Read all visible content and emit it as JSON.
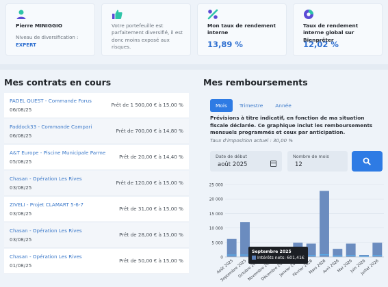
{
  "cards": [
    {
      "icon": "user-icon",
      "title": "Pierre MINIGGIO",
      "sub_label": "Niveau de diversification :",
      "level": "EXPERT"
    },
    {
      "icon": "thumbs-up-icon",
      "text": "Votre portefeuille est parfaitement diversifié, il est donc moins exposé aux risques."
    },
    {
      "icon": "percent-icon",
      "title": "Mon taux de rendement interne",
      "value": "13,89 %"
    },
    {
      "icon": "chart-circle-icon",
      "title": "Taux de rendement interne global sur Bienprêter",
      "value": "12,02 %"
    }
  ],
  "contracts": {
    "title": "Mes contrats en cours",
    "rows": [
      {
        "name": "PADEL QUEST - Commande Forus",
        "date": "06/08/25",
        "loan": "Prêt de 1 500,00 € à 15,00 %"
      },
      {
        "name": "Paddock33 - Commande Campari",
        "date": "06/08/25",
        "loan": "Prêt de 700,00 € à 14,80 %"
      },
      {
        "name": "A&T Europe - Piscine Municipale Parme",
        "date": "05/08/25",
        "loan": "Prêt de 20,00 € à 14,40 %"
      },
      {
        "name": "Chasan - Opération Les Rives",
        "date": "03/08/25",
        "loan": "Prêt de 120,00 € à 15,00 %"
      },
      {
        "name": "ZIVELI - Projet CLAMART 5-6-7",
        "date": "03/08/25",
        "loan": "Prêt de 31,00 € à 15,00 %"
      },
      {
        "name": "Chasan - Opération Les Rives",
        "date": "03/08/25",
        "loan": "Prêt de 28,00 € à 15,00 %"
      },
      {
        "name": "Chasan - Opération Les Rives",
        "date": "01/08/25",
        "loan": "Prêt de 50,00 € à 15,00 %"
      }
    ]
  },
  "repayments": {
    "title": "Mes remboursements",
    "tabs": [
      "Mois",
      "Trimestre",
      "Année"
    ],
    "active_tab": "Mois",
    "description": "Prévisions à titre indicatif, en fonction de ma situation fiscale déclarée. Ce graphique inclut les remboursements mensuels programmés et ceux par anticipation.",
    "tax_note": "Taux d'imposition actuel : 30,00 %",
    "start_label": "Date de début",
    "start_value": "août 2025",
    "months_label": "Nombre de mois",
    "months_value": "12",
    "tooltip_title": "Septembre 2025",
    "tooltip_value": "Intérêts nets: 601,41€"
  },
  "colors": {
    "accent": "#2e7be4",
    "bar": "#6b8cbf",
    "bar_light": "#5aa9e6"
  },
  "chart_data": {
    "type": "bar",
    "categories": [
      "Août 2025",
      "Septembre 2025",
      "Octobre 2025",
      "Novembre 2025",
      "Décembre 2025",
      "Janvier 2026",
      "Février 2026",
      "Mars 2026",
      "Avril 2026",
      "Mai 2026",
      "Juin 2026",
      "Juillet 2026"
    ],
    "series": [
      {
        "values": [
          6200,
          12000,
          1500,
          400,
          300,
          4900,
          4600,
          22800,
          2800,
          4600,
          700,
          4900
        ]
      },
      {
        "name": "Intérêts nets",
        "values": [
          600,
          601.41,
          300,
          100,
          100,
          500,
          450,
          700,
          300,
          450,
          150,
          450
        ]
      }
    ],
    "yticks": [
      "0",
      "5 000",
      "10 000",
      "15 000",
      "20 000",
      "25 000"
    ],
    "ylim": [
      0,
      25000
    ]
  }
}
